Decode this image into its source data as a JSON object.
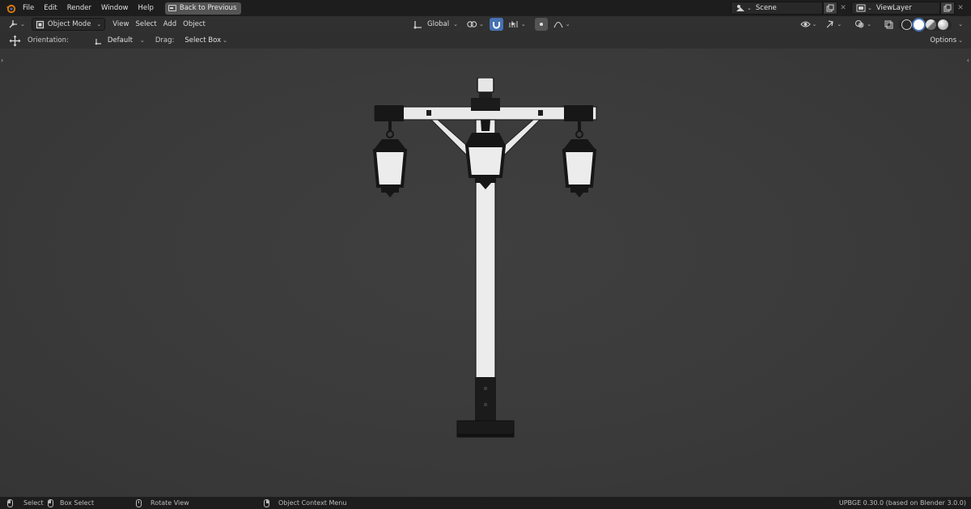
{
  "topbar": {
    "menus": [
      "File",
      "Edit",
      "Render",
      "Window",
      "Help"
    ],
    "back_label": "Back to Previous",
    "scene_value": "Scene",
    "viewlayer_value": "ViewLayer"
  },
  "header": {
    "mode_label": "Object Mode",
    "menus": [
      "View",
      "Select",
      "Add",
      "Object"
    ],
    "transform_orientation": "Global",
    "options_label": "Options"
  },
  "toolrow": {
    "orientation_label": "Orientation:",
    "orientation_value": "Default",
    "drag_label": "Drag:",
    "drag_value": "Select Box"
  },
  "statusbar": {
    "select": "Select",
    "box_select": "Box Select",
    "rotate_view": "Rotate View",
    "context_menu": "Object Context Menu",
    "version": "UPBGE 0.30.0 (based on Blender 3.0.0)"
  },
  "colors": {
    "topbar_bg": "#1d1d1d",
    "header_bg": "#303030",
    "viewport_bg": "#3b3b3b",
    "accent_blue": "#4772b3"
  },
  "icons": {
    "logo": "blender-logo-icon",
    "editor_type": "3d-viewport-icon",
    "transform": "transform-gizmo-icon"
  }
}
